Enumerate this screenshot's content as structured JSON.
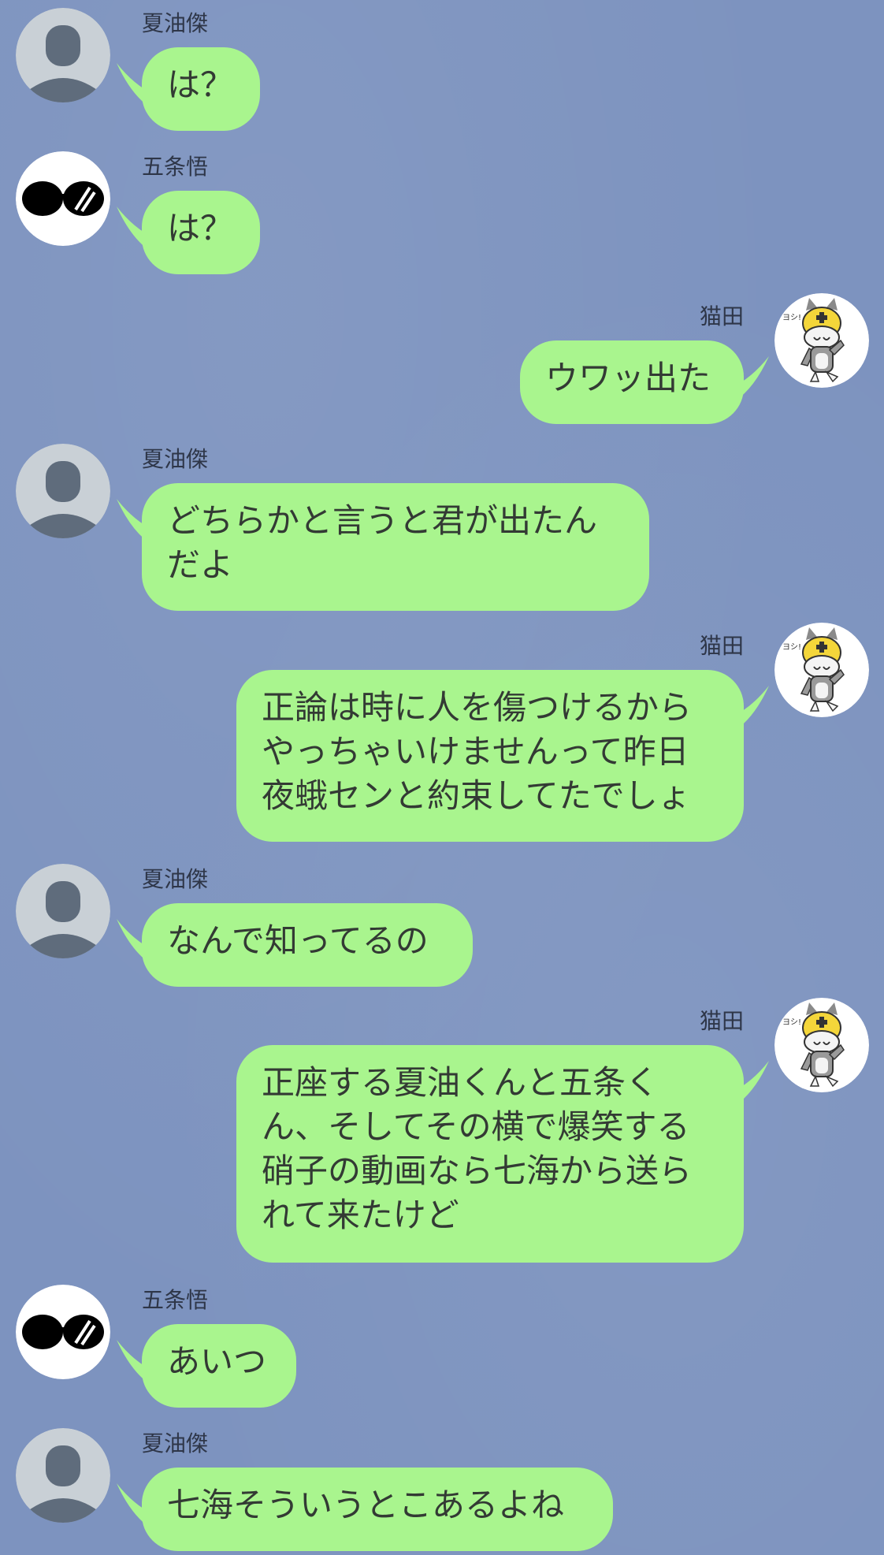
{
  "colors": {
    "background": "#7d93bf",
    "bubble": "#a9f58e",
    "text": "#333a34",
    "sender_text": "#2e3648"
  },
  "messages": [
    {
      "sender": "夏油傑",
      "side": "left",
      "avatar": "default-person-icon",
      "text": "は？"
    },
    {
      "sender": "五条悟",
      "side": "left",
      "avatar": "sunglasses-icon",
      "text": "は？"
    },
    {
      "sender": "猫田",
      "side": "right",
      "avatar": "cat-mascot-icon",
      "text": "ウワッ出た"
    },
    {
      "sender": "夏油傑",
      "side": "left",
      "avatar": "default-person-icon",
      "text": "どちらかと言うと君が出たん\nだよ"
    },
    {
      "sender": "猫田",
      "side": "right",
      "avatar": "cat-mascot-icon",
      "text": "正論は時に人を傷つけるから\nやっちゃいけませんって昨日\n夜蛾センと約束してたでしょ"
    },
    {
      "sender": "夏油傑",
      "side": "left",
      "avatar": "default-person-icon",
      "text": "なんで知ってるの"
    },
    {
      "sender": "猫田",
      "side": "right",
      "avatar": "cat-mascot-icon",
      "text": "正座する夏油くんと五条く\nん、そしてその横で爆笑する\n硝子の動画なら七海から送ら\nれて来たけど"
    },
    {
      "sender": "五条悟",
      "side": "left",
      "avatar": "sunglasses-icon",
      "text": "あいつ"
    },
    {
      "sender": "夏油傑",
      "side": "left",
      "avatar": "default-person-icon",
      "text": "七海そういうとこあるよね"
    }
  ]
}
